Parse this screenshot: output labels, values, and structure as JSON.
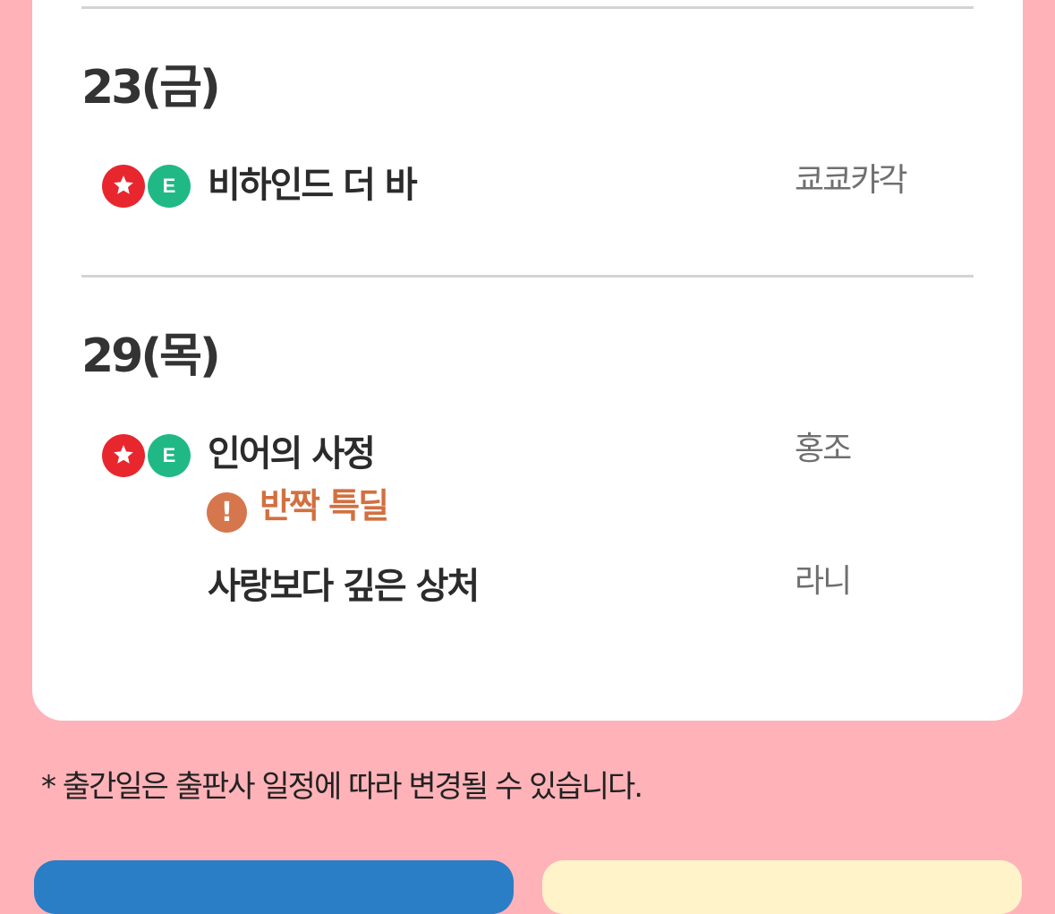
{
  "schedule": [
    {
      "date": "23(금)",
      "books": [
        {
          "title": "비하인드 더 바",
          "author": "쿄쿄캬각",
          "badges": [
            "star-icon",
            "e-icon"
          ]
        }
      ]
    },
    {
      "date": "29(목)",
      "books": [
        {
          "title": "인어의 사정",
          "author": "홍조",
          "badges": [
            "star-icon",
            "e-icon"
          ],
          "promo": "반짝 특딜"
        },
        {
          "title": "사랑보다 깊은 상처",
          "author": "라니"
        }
      ]
    }
  ],
  "badge_e_label": "E",
  "alert_icon_glyph": "!",
  "notice": "* 출간일은 출판사 일정에 따라 변경될 수 있습니다.",
  "colors": {
    "background": "#ffb3b8",
    "star_badge": "#e8262e",
    "e_badge": "#20b986",
    "promo": "#d2703f",
    "button_blue": "#2a7ec5",
    "button_yellow": "#fff3c9"
  }
}
